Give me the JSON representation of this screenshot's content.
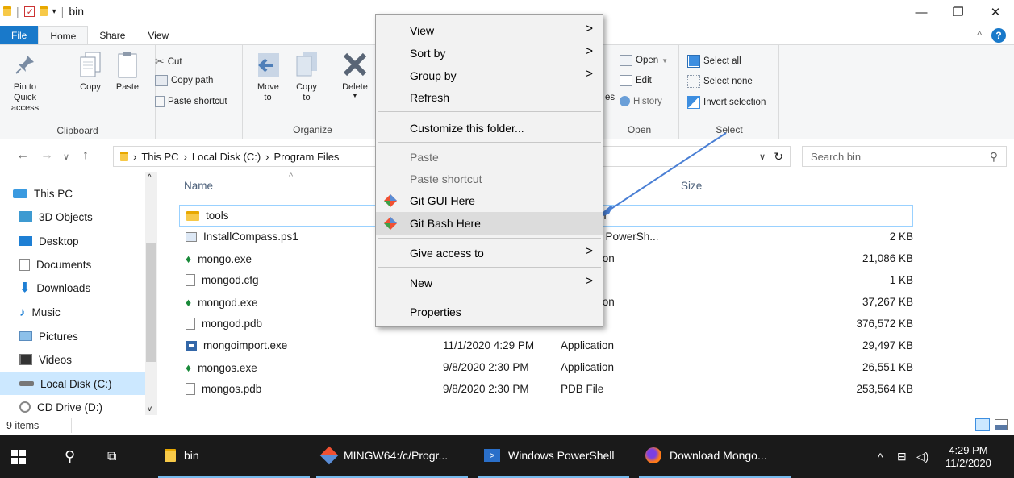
{
  "window": {
    "title": "bin"
  },
  "ribbon_tabs": [
    "File",
    "Home",
    "Share",
    "View"
  ],
  "clipboard": {
    "pin_label": "Pin to Quick access",
    "copy_label": "Copy",
    "paste_label": "Paste",
    "cut_label": "Cut",
    "copy_path_label": "Copy path",
    "paste_shortcut_label": "Paste shortcut",
    "group_label": "Clipboard"
  },
  "organize": {
    "move_label": "Move to",
    "copy_to_label": "Copy to",
    "delete_label": "Delete",
    "group_label": "Organize"
  },
  "open_group": {
    "open_label": "Open",
    "edit_label": "Edit",
    "history_label": "History",
    "partial_label": "es",
    "group_label": "Open"
  },
  "select_group": {
    "select_all": "Select all",
    "select_none": "Select none",
    "invert": "Invert selection",
    "group_label": "Select"
  },
  "address": {
    "crumbs": [
      "This PC",
      "Local Disk (C:)",
      "Program Files"
    ],
    "search_placeholder": "Search bin"
  },
  "nav_pane": [
    {
      "label": "This PC",
      "icon": "computer-icon"
    },
    {
      "label": "3D Objects",
      "icon": "3d-objects-icon"
    },
    {
      "label": "Desktop",
      "icon": "desktop-icon"
    },
    {
      "label": "Documents",
      "icon": "documents-icon"
    },
    {
      "label": "Downloads",
      "icon": "downloads-icon"
    },
    {
      "label": "Music",
      "icon": "music-icon"
    },
    {
      "label": "Pictures",
      "icon": "pictures-icon"
    },
    {
      "label": "Videos",
      "icon": "videos-icon"
    },
    {
      "label": "Local Disk (C:)",
      "icon": "drive-icon"
    },
    {
      "label": "CD Drive (D:)",
      "icon": "cd-drive-icon"
    }
  ],
  "columns": {
    "name": "Name",
    "size": "Size"
  },
  "files": [
    {
      "name": "tools",
      "date": "",
      "type": "er",
      "size": ""
    },
    {
      "name": "InstallCompass.ps1",
      "date": "",
      "type": "s PowerSh...",
      "size": "2 KB"
    },
    {
      "name": "mongo.exe",
      "date": "",
      "type": "tion",
      "size": "21,086 KB"
    },
    {
      "name": "mongod.cfg",
      "date": "",
      "type": "",
      "size": "1 KB"
    },
    {
      "name": "mongod.exe",
      "date": "",
      "type": "tion",
      "size": "37,267 KB"
    },
    {
      "name": "mongod.pdb",
      "date": "9/8/2020 2:30 PM",
      "type": "PDB File",
      "size": "376,572 KB"
    },
    {
      "name": "mongoimport.exe",
      "date": "11/1/2020 4:29 PM",
      "type": "Application",
      "size": "29,497 KB"
    },
    {
      "name": "mongos.exe",
      "date": "9/8/2020 2:30 PM",
      "type": "Application",
      "size": "26,551 KB"
    },
    {
      "name": "mongos.pdb",
      "date": "9/8/2020 2:30 PM",
      "type": "PDB File",
      "size": "253,564 KB"
    }
  ],
  "status": {
    "count": "9 items"
  },
  "context_menu": {
    "view": "View",
    "sort_by": "Sort by",
    "group_by": "Group by",
    "refresh": "Refresh",
    "customize": "Customize this folder...",
    "paste": "Paste",
    "paste_shortcut": "Paste shortcut",
    "git_gui": "Git GUI Here",
    "git_bash": "Git Bash Here",
    "give_access": "Give access to",
    "new": "New",
    "properties": "Properties"
  },
  "taskbar": {
    "items": [
      "bin",
      "MINGW64:/c/Progr...",
      "Windows PowerShell",
      "Download Mongo..."
    ],
    "time": "4:29 PM",
    "date": "11/2/2020"
  },
  "colors": {
    "accent": "#1979ca",
    "selection": "#cce8ff",
    "taskbar": "#1a1a1a",
    "annotation": "#4a7fd4"
  }
}
